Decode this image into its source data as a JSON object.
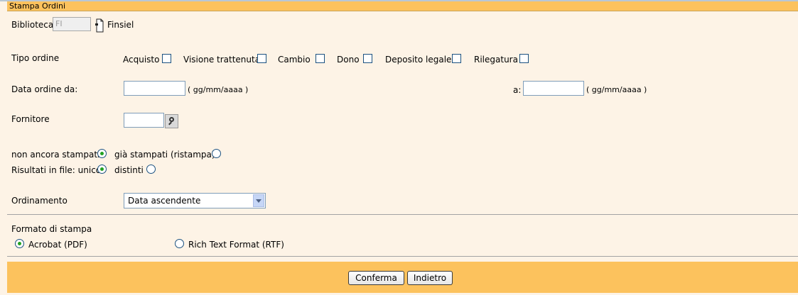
{
  "title": "Stampa Ordini",
  "biblioteca": {
    "label": "Biblioteca",
    "value": "FI",
    "provider": "Finsiel"
  },
  "tipo_ordine": {
    "label": "Tipo ordine",
    "options": [
      "Acquisto",
      "Visione trattenuta",
      "Cambio",
      "Dono",
      "Deposito legale",
      "Rilegatura"
    ]
  },
  "data_ordine": {
    "label_from": "Data ordine da:",
    "hint": "( gg/mm/aaaa )",
    "label_to": "a:"
  },
  "fornitore": {
    "label": "Fornitore"
  },
  "stampati": {
    "not_printed": "non ancora stampati",
    "printed": "già stampati (ristampa)",
    "selected": "non ancora stampati"
  },
  "risultati": {
    "label": "Risultati in file: unico",
    "distinct": "distinti",
    "selected": "unico"
  },
  "ordinamento": {
    "label": "Ordinamento",
    "selected": "Data ascendente"
  },
  "formato": {
    "label": "Formato di stampa",
    "pdf": "Acrobat (PDF)",
    "rtf": "Rich Text Format (RTF)",
    "selected": "pdf"
  },
  "buttons": {
    "confirm": "Conferma",
    "back": "Indietro"
  },
  "colors": {
    "header": "#fcc25d",
    "background": "#fdf3e6",
    "radio_selected": "#21a121"
  }
}
